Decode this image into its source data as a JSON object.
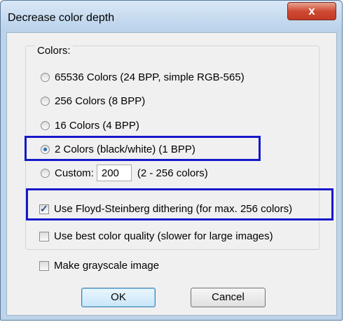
{
  "dialog": {
    "title": "Decrease color depth",
    "close_label": "x"
  },
  "colors": {
    "group_label": "Colors:",
    "options": [
      "65536 Colors (24 BPP, simple RGB-565)",
      "256 Colors (8 BPP)",
      "16 Colors (4 BPP)",
      "2 Colors (black/white) (1 BPP)"
    ],
    "selected_index": 3,
    "custom_label": "Custom:",
    "custom_value": "200",
    "custom_range": "(2 - 256 colors)"
  },
  "checkboxes": [
    {
      "label": "Use Floyd-Steinberg dithering (for max. 256 colors)",
      "checked": true
    },
    {
      "label": "Use best color quality (slower for large images)",
      "checked": false
    },
    {
      "label": "Make grayscale image",
      "checked": false
    }
  ],
  "buttons": {
    "ok_label": "OK",
    "cancel_label": "Cancel"
  },
  "annotation_color": "#1518c9"
}
